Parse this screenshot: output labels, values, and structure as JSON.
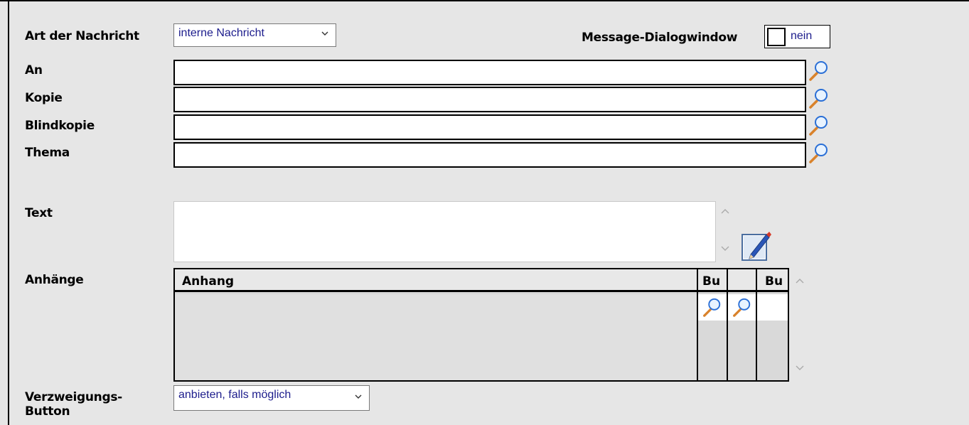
{
  "form": {
    "message_type": {
      "label": "Art der Nachricht",
      "value": "interne Nachricht"
    },
    "dialog_window": {
      "label": "Message-Dialogwindow",
      "value": "nein"
    },
    "to": {
      "label": "An",
      "value": ""
    },
    "cc": {
      "label": "Kopie",
      "value": ""
    },
    "bcc": {
      "label": "Blindkopie",
      "value": ""
    },
    "subject": {
      "label": "Thema",
      "value": ""
    },
    "text": {
      "label": "Text",
      "value": ""
    },
    "attachments": {
      "label": "Anhänge",
      "columns": [
        "Anhang",
        "Bu",
        "",
        "Bu"
      ]
    },
    "branch_button": {
      "label_line1": "Verzweigungs-",
      "label_line2": "Button",
      "value": "anbieten, falls möglich"
    }
  },
  "icons": {
    "lookup": "magnifier-icon",
    "edit": "edit-pencil-icon"
  },
  "colors": {
    "background": "#e6e6e6",
    "combo_text": "#1c1c8c",
    "lens_rim": "#2a6fd6",
    "lens_handle": "#d9822b"
  }
}
